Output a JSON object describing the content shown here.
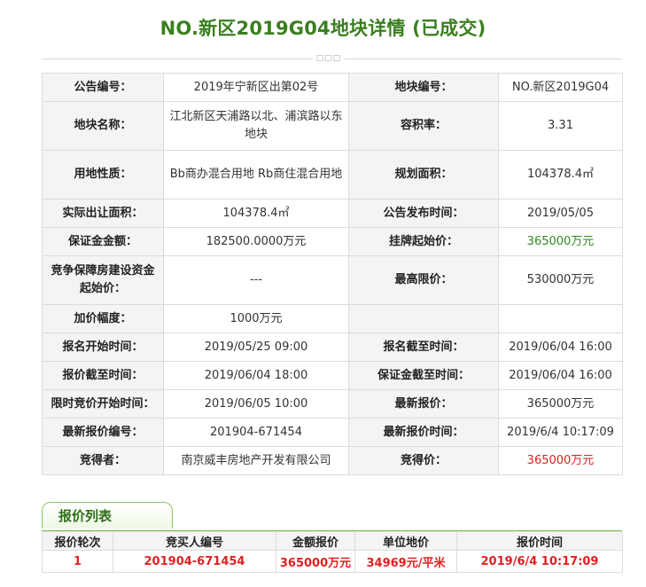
{
  "page_title": "NO.新区2019G04地块详情 (已成交)",
  "details": [
    [
      {
        "label": "公告编号：",
        "value": "2019年宁新区出第02号"
      },
      {
        "label": "地块编号：",
        "value": "NO.新区2019G04"
      }
    ],
    [
      {
        "label": "地块名称：",
        "value": "江北新区天浦路以北、浦滨路以东地块"
      },
      {
        "label": "容积率：",
        "value": "3.31"
      }
    ],
    [
      {
        "label": "用地性质：",
        "value": "Bb商办混合用地 Rb商住混合用地"
      },
      {
        "label": "规划面积：",
        "value": "104378.4㎡"
      }
    ],
    [
      {
        "label": "实际出让面积：",
        "value": "104378.4㎡"
      },
      {
        "label": "公告发布时间：",
        "value": "2019/05/05"
      }
    ],
    [
      {
        "label": "保证金金额：",
        "value": "182500.0000万元"
      },
      {
        "label": "挂牌起始价：",
        "value": "365000万元",
        "color": "green"
      }
    ],
    [
      {
        "label": "竞争保障房建设资金起始价：",
        "value": "---"
      },
      {
        "label": "最高限价：",
        "value": "530000万元"
      }
    ],
    [
      {
        "label": "加价幅度：",
        "value": "1000万元"
      },
      {
        "label": "",
        "value": ""
      }
    ],
    [
      {
        "label": "报名开始时间：",
        "value": "2019/05/25 09:00"
      },
      {
        "label": "报名截至时间：",
        "value": "2019/06/04 16:00"
      }
    ],
    [
      {
        "label": "报价截至时间：",
        "value": "2019/06/04 18:00"
      },
      {
        "label": "保证金截至时间：",
        "value": "2019/06/04 16:00"
      }
    ],
    [
      {
        "label": "限时竞价开始时间：",
        "value": "2019/06/05 10:00"
      },
      {
        "label": "最新报价：",
        "value": "365000万元"
      }
    ],
    [
      {
        "label": "最新报价编号：",
        "value": "201904-671454"
      },
      {
        "label": "最新报价时间：",
        "value": "2019/6/4 10:17:09"
      }
    ],
    [
      {
        "label": "竞得者：",
        "value": "南京威丰房地产开发有限公司"
      },
      {
        "label": "竞得价：",
        "value": "365000万元",
        "color": "red"
      }
    ]
  ],
  "bid_list": {
    "tab_label": "报价列表",
    "columns": [
      "报价轮次",
      "竞买人编号",
      "金额报价",
      "单位地价",
      "报价时间"
    ],
    "rows": [
      [
        "1",
        "201904-671454",
        "365000万元",
        "34969元/平米",
        "2019/6/4 10:17:09"
      ]
    ]
  },
  "colors": {
    "title": "#3a7f1f",
    "green_value": "#2e8b1e",
    "red_value": "#e02020"
  }
}
